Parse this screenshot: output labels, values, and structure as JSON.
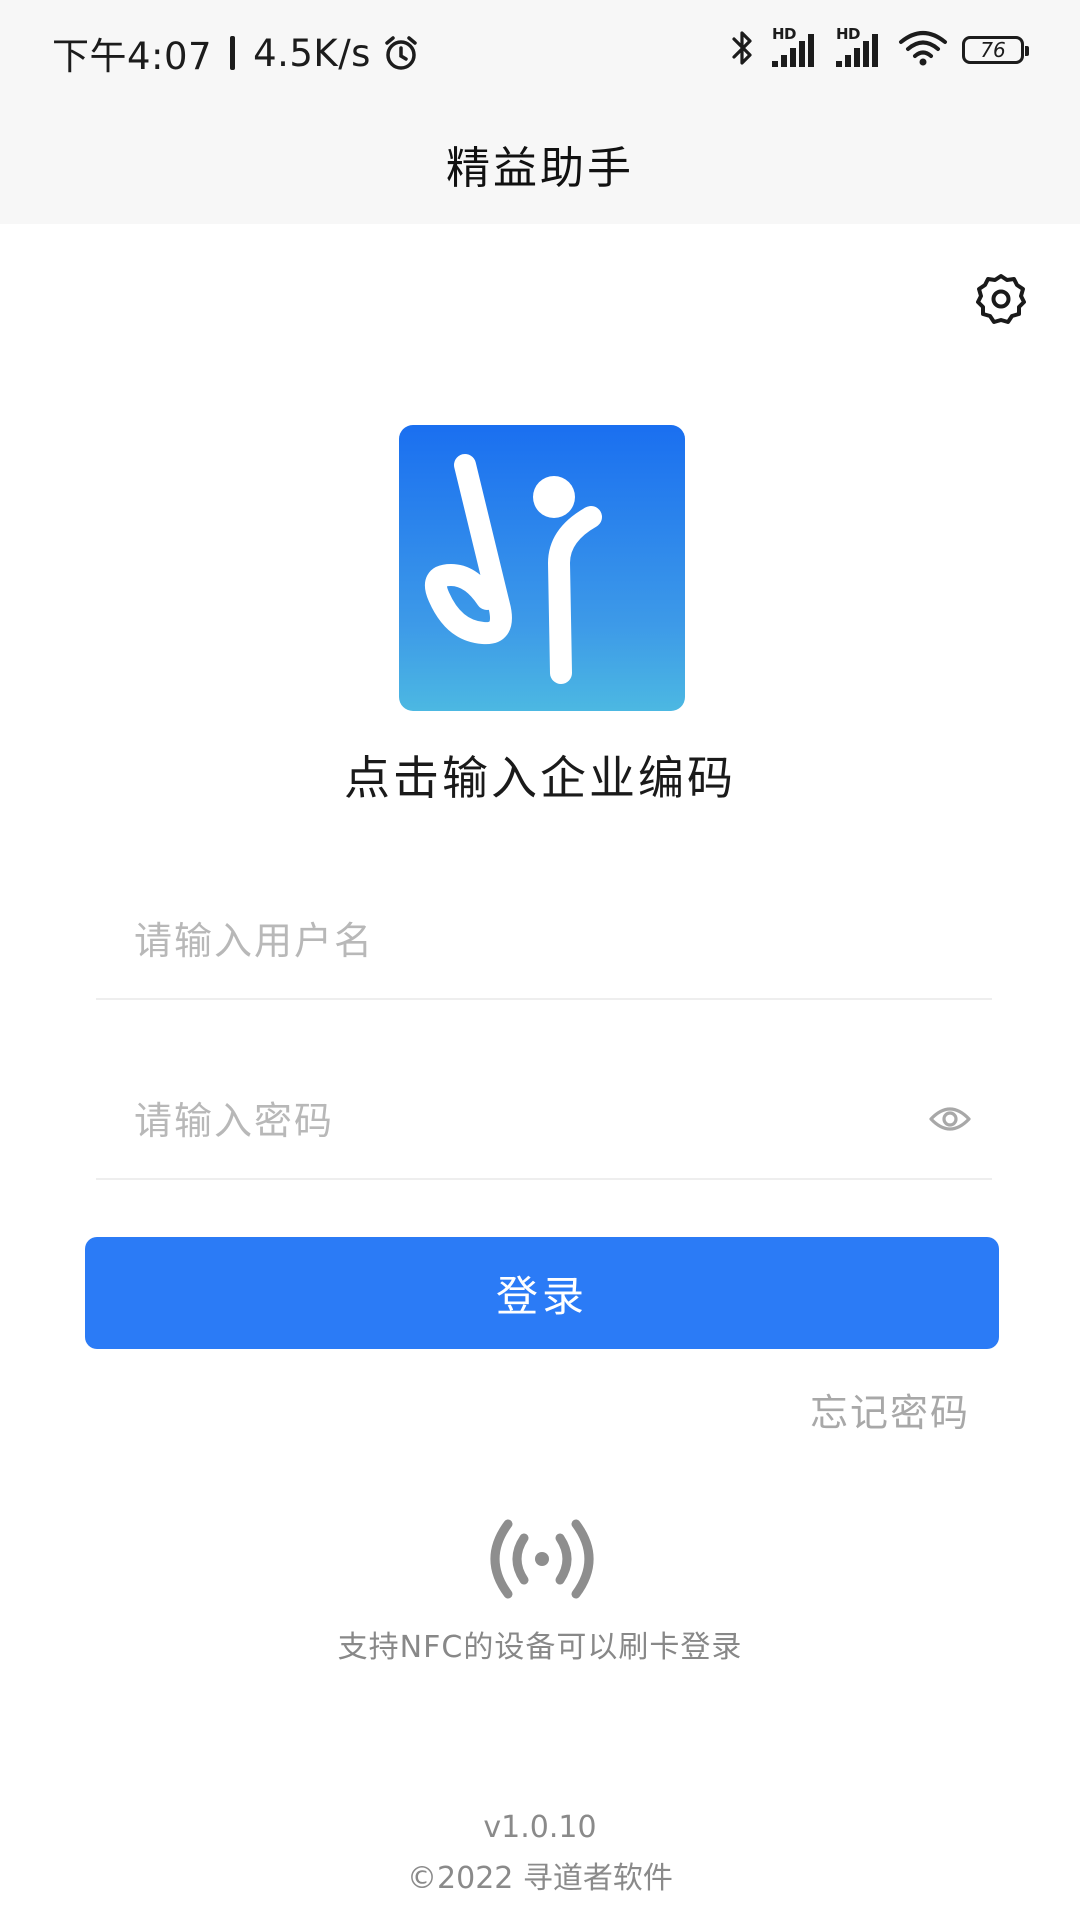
{
  "status_bar": {
    "time": "下午4:07",
    "net_speed": "4.5K/s",
    "battery_level": "76",
    "icons": [
      "alarm-icon",
      "bluetooth-icon",
      "hd-signal-icon",
      "hd-signal-icon",
      "wifi-icon",
      "battery-icon"
    ]
  },
  "header": {
    "title": "精益助手"
  },
  "settings": {
    "icon": "gear-icon"
  },
  "logo": {
    "icon": "app-logo"
  },
  "enterprise_code": {
    "label": "点击输入企业编码"
  },
  "form": {
    "username_placeholder": "请输入用户名",
    "username_value": "",
    "password_placeholder": "请输入密码",
    "password_value": "",
    "password_toggle_icon": "eye-icon",
    "login_label": "登录",
    "forgot_label": "忘记密码"
  },
  "nfc": {
    "icon": "nfc-icon",
    "text": "支持NFC的设备可以刷卡登录"
  },
  "footer": {
    "version": "v1.0.10",
    "copyright": "©2022 寻道者软件"
  },
  "colors": {
    "primary": "#2b7bf6",
    "logo_top": "#1a6ff0",
    "logo_bottom": "#4cb8e2",
    "bar_bg": "#f7f7f7",
    "placeholder": "#b8b8b8",
    "muted": "#8a8a8a"
  }
}
